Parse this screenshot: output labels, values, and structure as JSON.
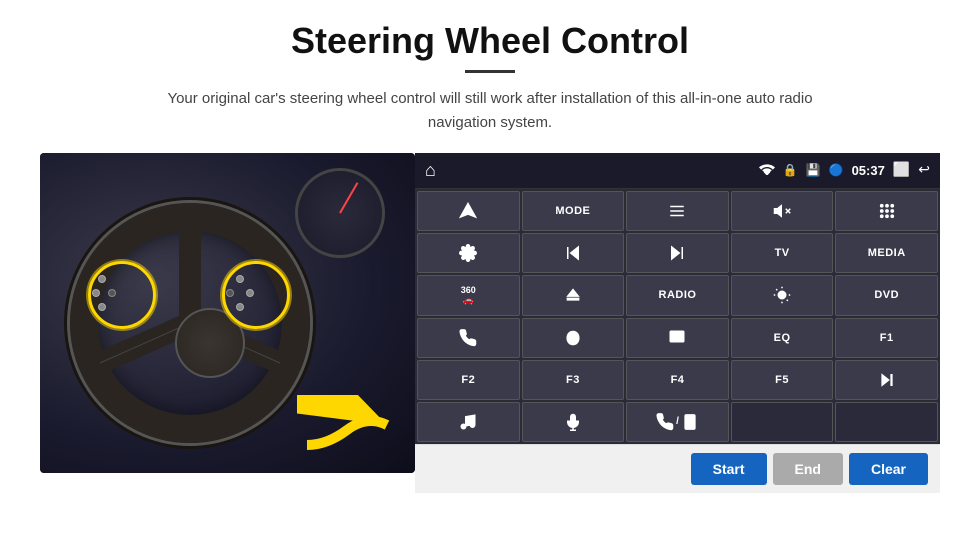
{
  "page": {
    "title": "Steering Wheel Control",
    "subtitle": "Your original car's steering wheel control will still work after installation of this all-in-one auto radio navigation system.",
    "divider": "—"
  },
  "topbar": {
    "time": "05:37",
    "home_icon": "⌂",
    "back_icon": "↩"
  },
  "panel_buttons": [
    {
      "id": "nav",
      "type": "icon",
      "icon": "nav"
    },
    {
      "id": "mode",
      "type": "text",
      "label": "MODE"
    },
    {
      "id": "list",
      "type": "icon",
      "icon": "list"
    },
    {
      "id": "mute",
      "type": "icon",
      "icon": "mute"
    },
    {
      "id": "apps",
      "type": "icon",
      "icon": "apps"
    },
    {
      "id": "settings",
      "type": "icon",
      "icon": "settings"
    },
    {
      "id": "prev",
      "type": "icon",
      "icon": "prev"
    },
    {
      "id": "next",
      "type": "icon",
      "icon": "next"
    },
    {
      "id": "tv",
      "type": "text",
      "label": "TV"
    },
    {
      "id": "media",
      "type": "text",
      "label": "MEDIA"
    },
    {
      "id": "360cam",
      "type": "icon",
      "icon": "360cam"
    },
    {
      "id": "eject",
      "type": "icon",
      "icon": "eject"
    },
    {
      "id": "radio",
      "type": "text",
      "label": "RADIO"
    },
    {
      "id": "brightness",
      "type": "icon",
      "icon": "brightness"
    },
    {
      "id": "dvd",
      "type": "text",
      "label": "DVD"
    },
    {
      "id": "phone",
      "type": "icon",
      "icon": "phone"
    },
    {
      "id": "swipe",
      "type": "icon",
      "icon": "swipe"
    },
    {
      "id": "window",
      "type": "icon",
      "icon": "window"
    },
    {
      "id": "eq",
      "type": "text",
      "label": "EQ"
    },
    {
      "id": "f1",
      "type": "text",
      "label": "F1"
    },
    {
      "id": "f2",
      "type": "text",
      "label": "F2"
    },
    {
      "id": "f3",
      "type": "text",
      "label": "F3"
    },
    {
      "id": "f4",
      "type": "text",
      "label": "F4"
    },
    {
      "id": "f5",
      "type": "text",
      "label": "F5"
    },
    {
      "id": "playpause",
      "type": "icon",
      "icon": "playpause"
    },
    {
      "id": "music",
      "type": "icon",
      "icon": "music"
    },
    {
      "id": "mic",
      "type": "icon",
      "icon": "mic"
    },
    {
      "id": "phonecall",
      "type": "icon",
      "icon": "phonecall"
    },
    {
      "id": "empty1",
      "type": "empty",
      "label": ""
    },
    {
      "id": "empty2",
      "type": "empty",
      "label": ""
    }
  ],
  "bottom_buttons": {
    "start": "Start",
    "end": "End",
    "clear": "Clear"
  }
}
